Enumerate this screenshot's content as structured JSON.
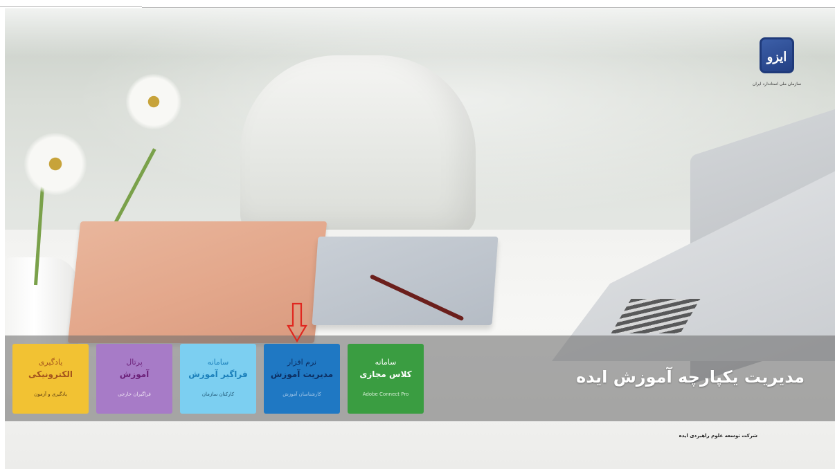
{
  "logo": {
    "mark": "ایزو",
    "org_name": "سازمان ملی استاندارد ایران"
  },
  "hero": {
    "title": "مدیریت یکپارچه آموزش ایده",
    "company": "شرکت توسعه علوم راهبردی ایده"
  },
  "tiles": [
    {
      "line1": "یادگیری",
      "line2": "الکترونیکی",
      "sub": "یادگیری و آزمون",
      "color": "#f2c233"
    },
    {
      "line1": "پرتال",
      "line2": "آموزش",
      "sub": "فراگیران خارجی",
      "color": "#a77bc7"
    },
    {
      "line1": "سامانه",
      "line2": "فراگیر آموزش",
      "sub": "کارکنان سازمان",
      "color": "#7ccff1"
    },
    {
      "line1": "نرم افزار",
      "line2": "مدیریت آموزش",
      "sub": "کارشناسان آموزش",
      "color": "#1f78c3"
    },
    {
      "line1": "سامانه",
      "line2": "کلاس مجازی",
      "sub": "Adobe Connect Pro",
      "color": "#3a9d41"
    }
  ],
  "annotation": {
    "arrow_color": "#e0271f",
    "target": "tile-training-management"
  }
}
